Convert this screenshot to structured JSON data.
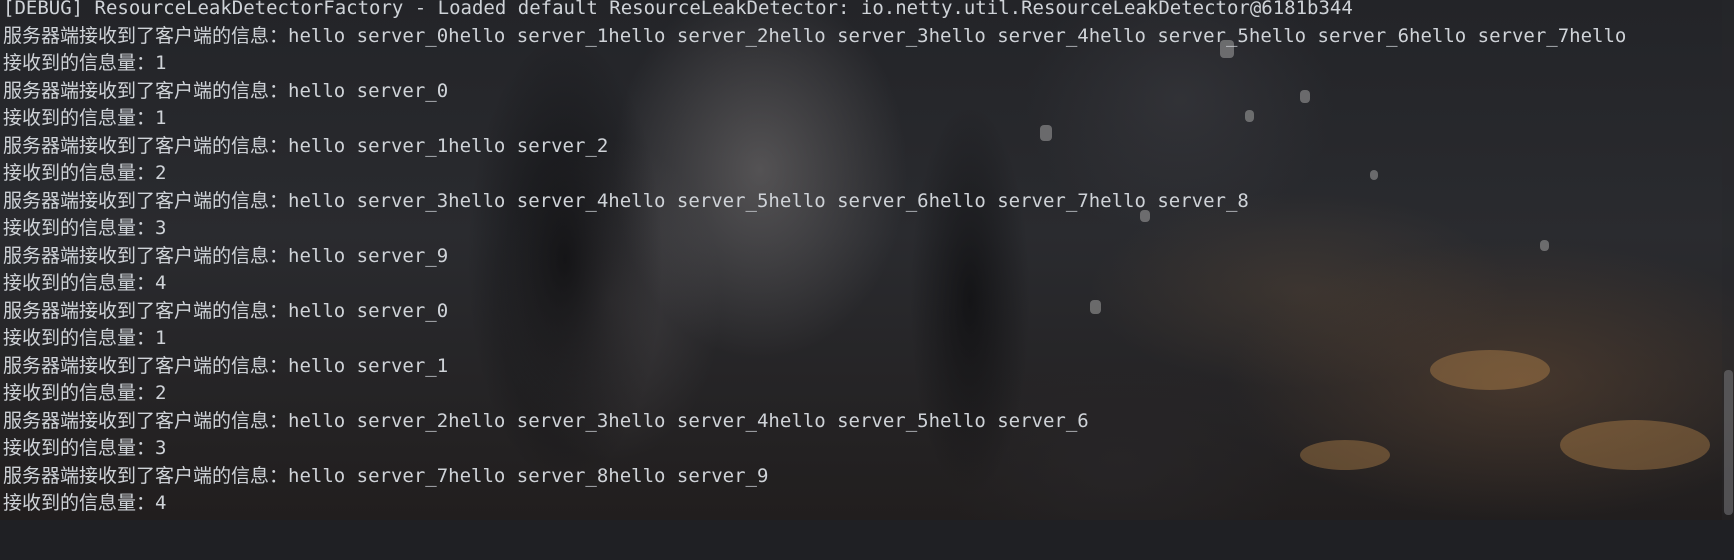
{
  "console": {
    "lines": [
      "[DEBUG] ResourceLeakDetectorFactory - Loaded default ResourceLeakDetector: io.netty.util.ResourceLeakDetector@6181b344",
      "服务器端接收到了客户端的信息：hello server_0hello server_1hello server_2hello server_3hello server_4hello server_5hello server_6hello server_7hello",
      "接收到的信息量：1",
      "服务器端接收到了客户端的信息：hello server_0",
      "接收到的信息量：1",
      "服务器端接收到了客户端的信息：hello server_1hello server_2",
      "接收到的信息量：2",
      "服务器端接收到了客户端的信息：hello server_3hello server_4hello server_5hello server_6hello server_7hello server_8",
      "接收到的信息量：3",
      "服务器端接收到了客户端的信息：hello server_9",
      "接收到的信息量：4",
      "服务器端接收到了客户端的信息：hello server_0",
      "接收到的信息量：1",
      "服务器端接收到了客户端的信息：hello server_1",
      "接收到的信息量：2",
      "服务器端接收到了客户端的信息：hello server_2hello server_3hello server_4hello server_5hello server_6",
      "接收到的信息量：3",
      "服务器端接收到了客户端的信息：hello server_7hello server_8hello server_9",
      "接收到的信息量：4"
    ]
  },
  "colors": {
    "text": "#cfd3d8",
    "background": "#1f2024"
  }
}
